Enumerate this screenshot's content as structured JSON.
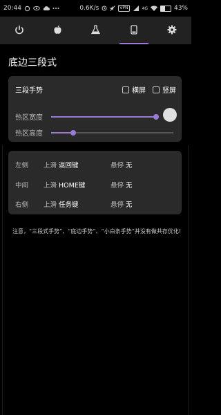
{
  "status_bar": {
    "time": "20:44",
    "speed": "0.6K/s",
    "vpn": "VPN",
    "signal": "4G",
    "battery": "43%",
    "battery_level": 0.43
  },
  "tabs": [
    {
      "icon": "power-icon",
      "active": false
    },
    {
      "icon": "apple-icon",
      "active": false
    },
    {
      "icon": "flask-icon",
      "active": false
    },
    {
      "icon": "phone-icon",
      "active": true
    },
    {
      "icon": "gear-icon",
      "active": false
    }
  ],
  "page": {
    "title": "底边三段式"
  },
  "gesture_card": {
    "label": "三段手势",
    "landscape_label": "横屏",
    "portrait_label": "竖屏",
    "hotzone_width_label": "热区宽度",
    "hotzone_width_value": 0.98,
    "hotzone_height_label": "热区高度",
    "hotzone_height_value": 0.18
  },
  "actions": [
    {
      "side": "左侧",
      "swipe_label": "上滑",
      "swipe_value": "返回键",
      "hover_label": "悬停",
      "hover_value": "无"
    },
    {
      "side": "中间",
      "swipe_label": "上滑",
      "swipe_value": "HOME键",
      "hover_label": "悬停",
      "hover_value": "无"
    },
    {
      "side": "右侧",
      "swipe_label": "上滑",
      "swipe_value": "任务键",
      "hover_label": "悬停",
      "hover_value": "无"
    }
  ],
  "note": "注意，“三段式手势”、“底边手势”、“小白条手势”并没有做共存优化!",
  "colors": {
    "accent": "#9a7ad6",
    "card": "#2a2a2a",
    "tabbar": "#222222",
    "background": "#000000"
  }
}
